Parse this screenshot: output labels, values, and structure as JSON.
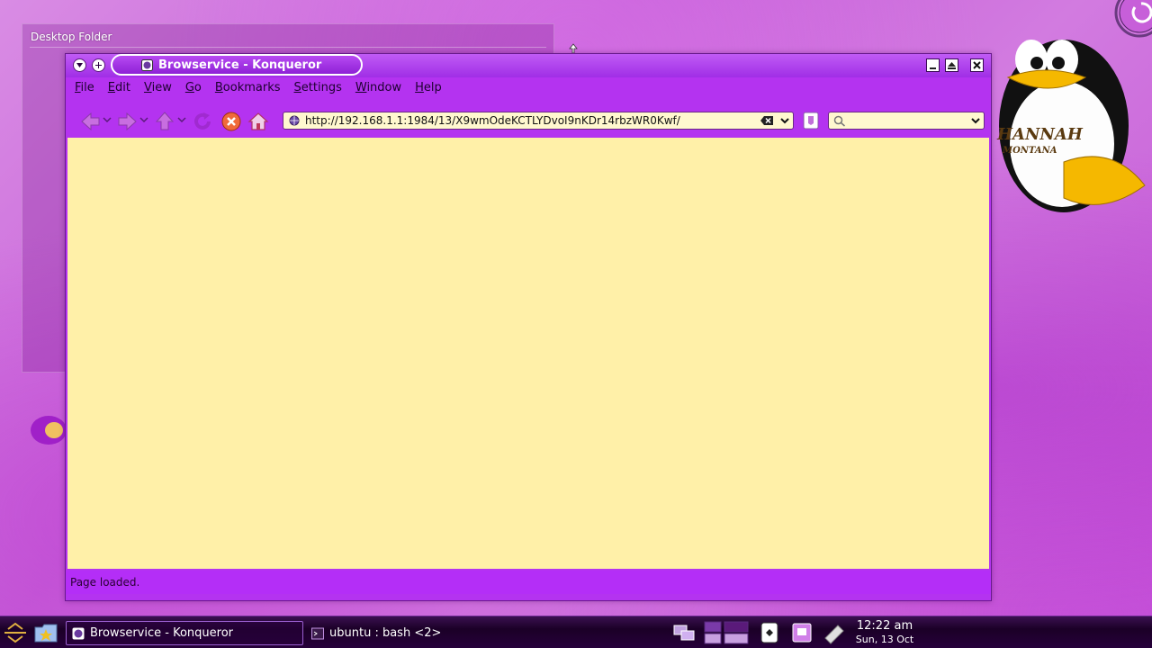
{
  "desktop": {
    "folder_title": "Desktop Folder"
  },
  "window": {
    "title": "Browservice - Konqueror",
    "menu": [
      "File",
      "Edit",
      "View",
      "Go",
      "Bookmarks",
      "Settings",
      "Window",
      "Help"
    ],
    "url": "http://192.168.1.1:1984/13/X9wmOdeKCTLYDvoI9nKDr14rbzWR0Kwf/",
    "search_value": "",
    "status": "Page loaded."
  },
  "taskbar": {
    "tasks": [
      {
        "label": "Browservice - Konqueror",
        "active": true
      },
      {
        "label": "ubuntu : bash <2>",
        "active": false
      }
    ],
    "clock": {
      "time": "12:22 am",
      "date": "Sun, 13 Oct"
    }
  },
  "icons": {
    "back": "back-arrow-icon",
    "forward": "forward-arrow-icon",
    "up": "up-arrow-icon",
    "reload": "reload-icon",
    "stop": "stop-icon",
    "home": "home-icon"
  },
  "colors": {
    "window_frame": "#b433f0",
    "content_bg": "#fff0a8",
    "taskbar_bg": "#1b0027"
  }
}
